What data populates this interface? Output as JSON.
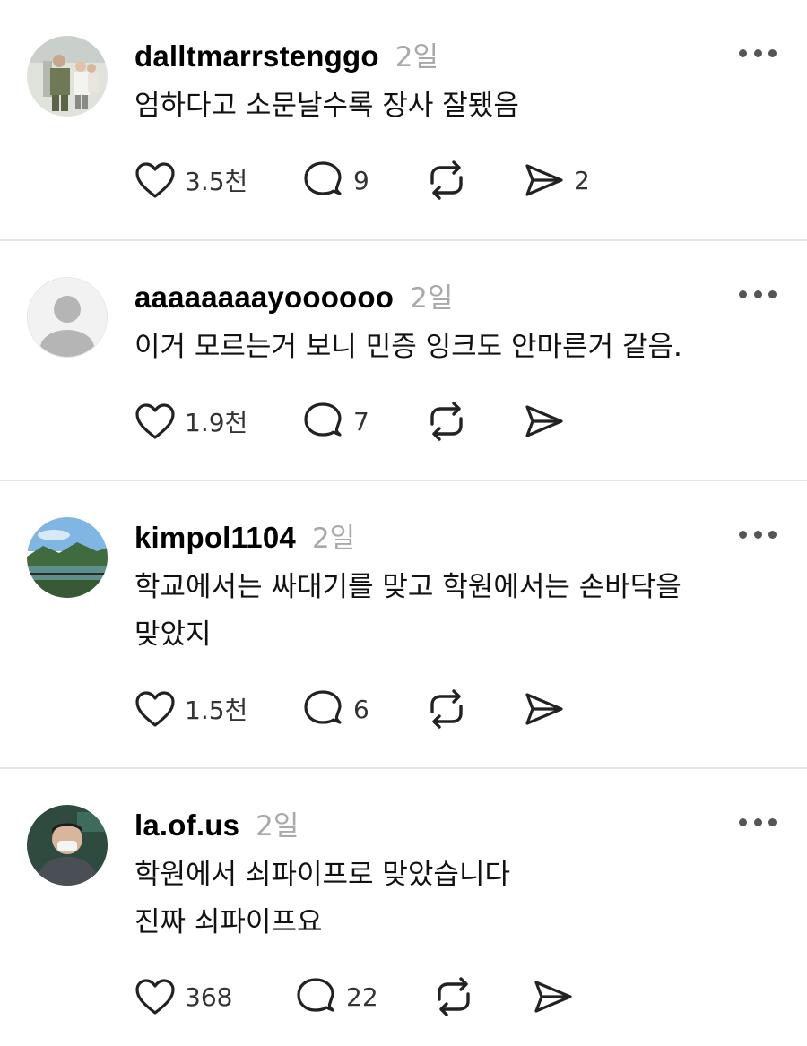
{
  "posts": [
    {
      "username": "dalltmarrstenggo",
      "time": "2일",
      "lines": [
        "엄하다고 소문날수록 장사 잘됐음"
      ],
      "likes": "3.5천",
      "replies": "9",
      "reposts": "",
      "shares": "2"
    },
    {
      "username": "aaaaaaaayoooooo",
      "time": "2일",
      "lines": [
        "이거 모르는거 보니 민증 잉크도 안마른거 같음."
      ],
      "likes": "1.9천",
      "replies": "7",
      "reposts": "",
      "shares": ""
    },
    {
      "username": "kimpol1104",
      "time": "2일",
      "lines": [
        "학교에서는 싸대기를 맞고 학원에서는 손바닥을",
        "맞았지"
      ],
      "likes": "1.5천",
      "replies": "6",
      "reposts": "",
      "shares": ""
    },
    {
      "username": "la.of.us",
      "time": "2일",
      "lines": [
        "학원에서 쇠파이프로 맞았습니다",
        "진짜 쇠파이프요"
      ],
      "likes": "368",
      "replies": "22",
      "reposts": "",
      "shares": ""
    }
  ],
  "icons": {
    "like": "heart-icon",
    "reply": "comment-icon",
    "repost": "repost-icon",
    "share": "send-icon",
    "more": "more-icon"
  }
}
